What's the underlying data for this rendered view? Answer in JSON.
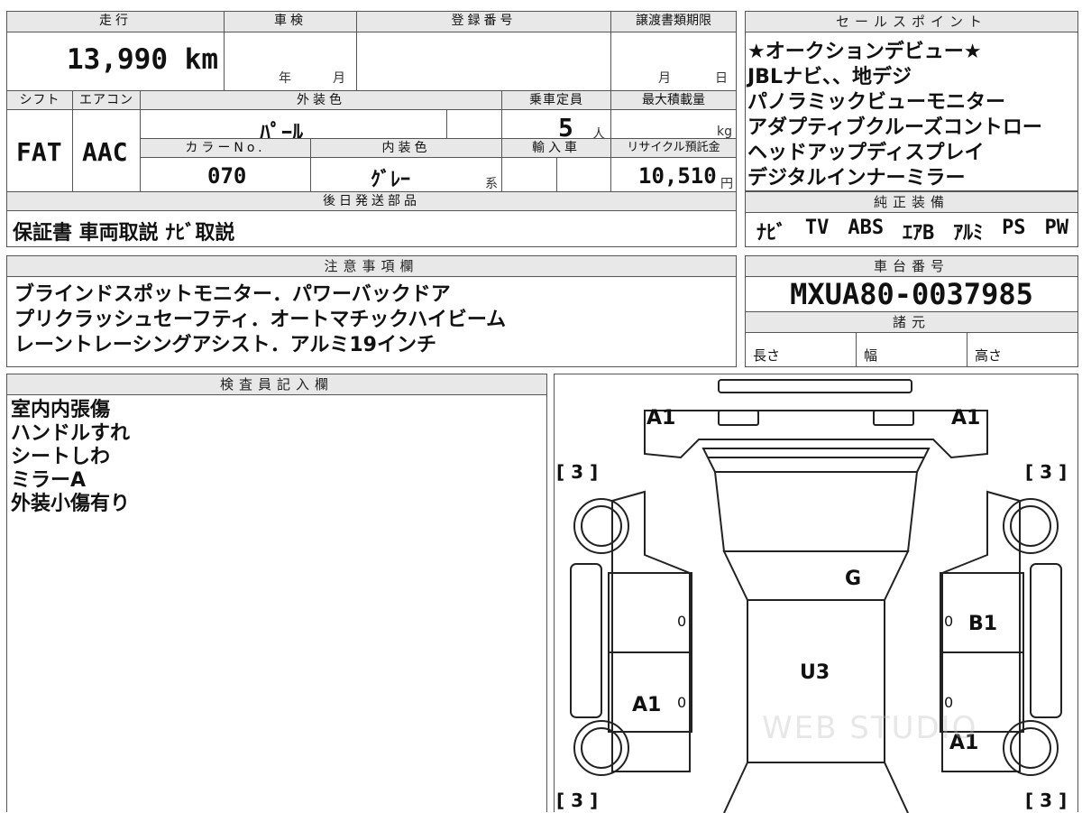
{
  "spec": {
    "mileage_label": "走行",
    "mileage_value": "13,990 km",
    "inspection_label": "車検",
    "inspection_year": "年",
    "inspection_month": "月",
    "registration_label": "登録番号",
    "transfer_deadline_label": "譲渡書類期限",
    "transfer_month": "月",
    "transfer_day": "日",
    "shift_label": "シフト",
    "shift_value": "FAT",
    "aircon_label": "エアコン",
    "aircon_value": "AAC",
    "exterior_color_label": "外装色",
    "exterior_color_value": "ﾊﾟｰﾙ",
    "capacity_label": "乗車定員",
    "capacity_value": "5",
    "capacity_unit": "人",
    "max_load_label": "最大積載量",
    "max_load_unit": "kg",
    "color_no_label": "カラーNo.",
    "color_no_value": "070",
    "interior_color_label": "内装色",
    "interior_color_value": "ｸﾞﾚｰ",
    "interior_color_suffix": "系",
    "import_label": "輸入車",
    "recycle_label": "リサイクル預託金",
    "recycle_value": "10,510",
    "recycle_unit": "円",
    "later_parts_label": "後日発送部品",
    "later_parts_value": "保証書 車両取説 ﾅﾋﾞ取説"
  },
  "sales_points": {
    "label": "セールスポイント",
    "items": [
      "★オークションデビュー★",
      "JBLナビ、、地デジ",
      "パノラミックビューモニター",
      "アダプティブクルーズコントロー",
      "ヘッドアップディスプレイ",
      "デジタルインナーミラー"
    ]
  },
  "standard_equipment": {
    "label": "純正装備",
    "items": [
      "ﾅﾋﾞ",
      "TV",
      "ABS",
      "ｴｱB",
      "ｱﾙﾐ",
      "PS",
      "PW"
    ]
  },
  "notes": {
    "label": "注意事項欄",
    "lines": [
      "ブラインドスポットモニター．パワーバックドア",
      "プリクラッシュセーフティ．オートマチックハイビーム",
      "レーントレーシングアシスト．アルミ19インチ"
    ]
  },
  "chassis": {
    "label": "車台番号",
    "value": "MXUA80-0037985",
    "specs_label": "諸元",
    "length_label": "長さ",
    "width_label": "幅",
    "height_label": "高さ"
  },
  "inspector": {
    "label": "検査員記入欄",
    "lines": [
      "室内内張傷",
      "ハンドルすれ",
      "シートしわ",
      "ミラーA",
      "外装小傷有り"
    ]
  },
  "diagram": {
    "marks": {
      "front_left": "A1",
      "front_right": "A1",
      "windshield": "G",
      "right_front_door": "B1",
      "roof": "U3",
      "left_rear_door": "A1",
      "right_rear": "A1",
      "door_zero": "0"
    },
    "tire_labels": {
      "front_left": "[ 3 ]",
      "front_right": "[ 3 ]",
      "rear_left": "[ 3 ]",
      "rear_right": "[ 3 ]"
    },
    "watermark": "WEB STUDIO"
  }
}
